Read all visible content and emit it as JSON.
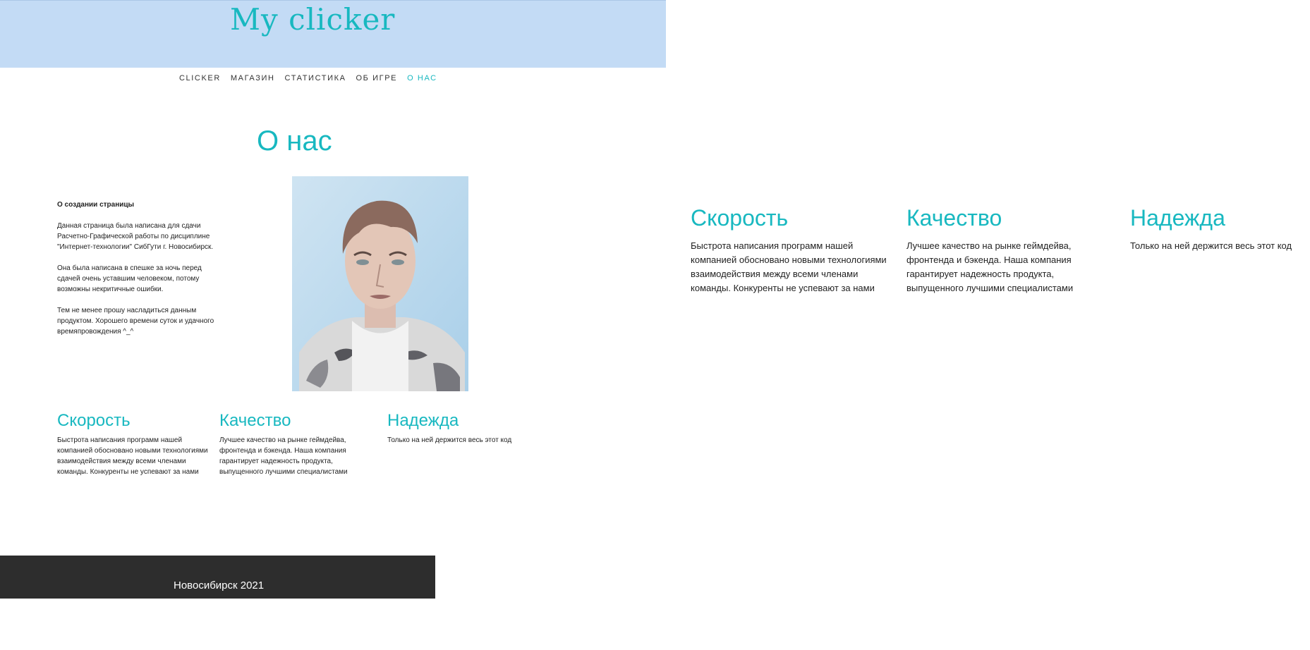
{
  "header": {
    "logo": "My clicker"
  },
  "nav": {
    "items": [
      {
        "label": "CLICKER"
      },
      {
        "label": "МАГАЗИН"
      },
      {
        "label": "СТАТИСТИКА"
      },
      {
        "label": "ОБ ИГРЕ"
      },
      {
        "label": "О НАС",
        "active": true
      }
    ]
  },
  "page": {
    "title": "О нас"
  },
  "about": {
    "heading": "О создании страницы",
    "paragraphs": [
      "Данная страница была написана для сдачи Расчетно-Графической работы по дисциплине \"Интернет-технологии\"   СибГути г. Новосибирск.",
      "Она была написана в спешке за ночь перед сдачей очень уставшим человеком, потому возможны некритичные ошибки.",
      "Тем не менее прошу насладиться данным продуктом. Хорошего времени суток и удачного времяпровождения ^_^"
    ]
  },
  "features": [
    {
      "title": "Скорость",
      "text": "Быстрота написания программ нашей компанией обосновано новыми технологиями взаимодействия между всеми членами команды. Конкуренты не успевают за нами"
    },
    {
      "title": "Качество",
      "text": "Лучшее качество на рынке геймдейва, фронтенда и бэкенда. Наша компания гарантирует надежность продукта, выпущенного лучшими специалистами"
    },
    {
      "title": "Надежда",
      "text": "Только на ней держится весь этот код"
    }
  ],
  "footer": {
    "text": "Новосибирск 2021"
  },
  "colors": {
    "accent": "#18b8c0",
    "header_bg": "#c3dbf5",
    "footer_bg": "#2d2d2d"
  }
}
